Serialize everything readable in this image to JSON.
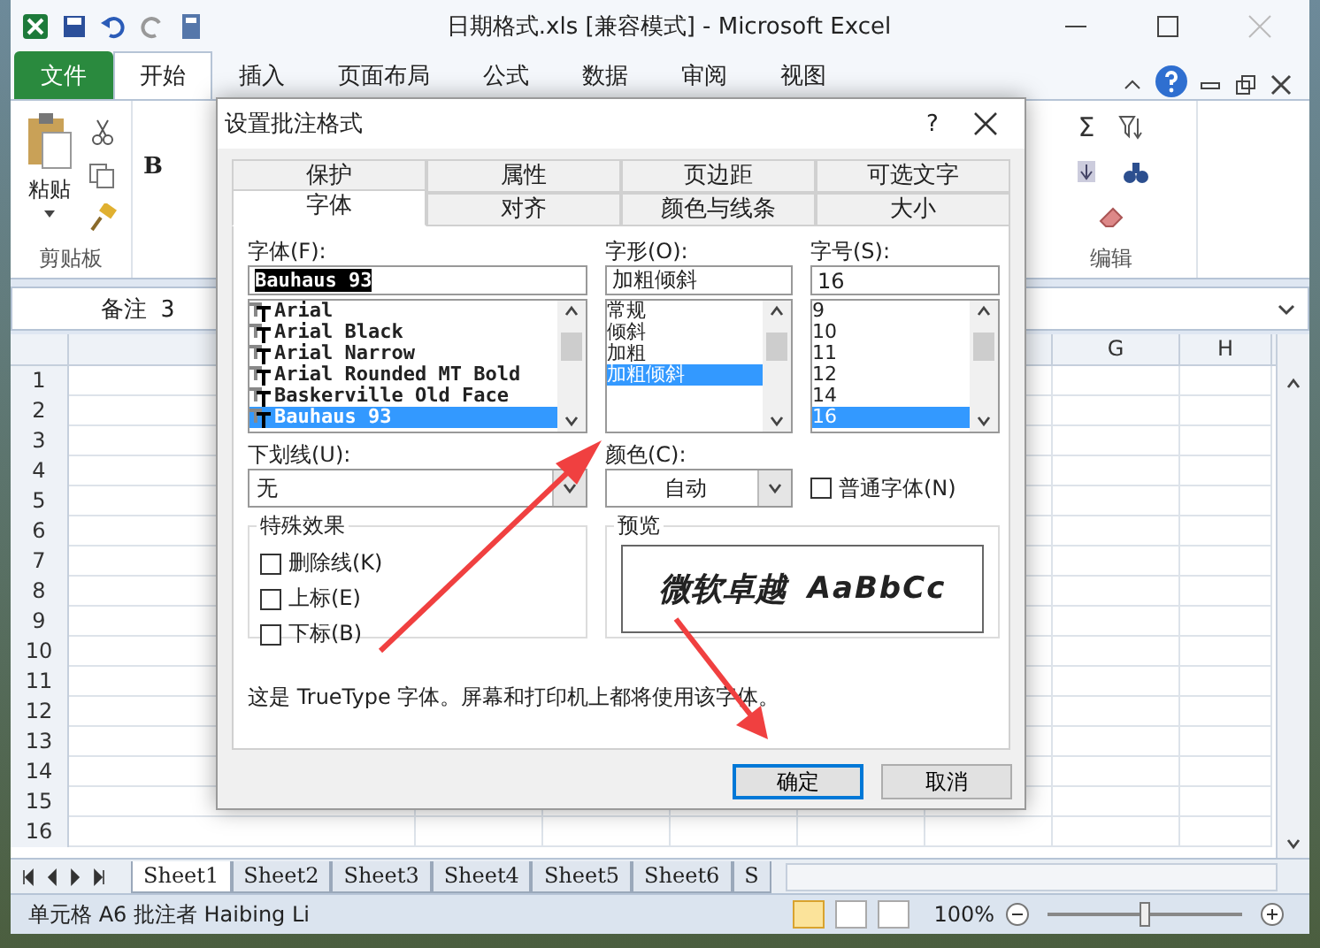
{
  "window": {
    "title": "日期格式.xls  [兼容模式]  -  Microsoft Excel"
  },
  "ribbon_tabs": [
    {
      "label": "文件",
      "kind": "file",
      "selected": false
    },
    {
      "label": "开始",
      "kind": "tab",
      "selected": true
    },
    {
      "label": "插入",
      "kind": "tab",
      "selected": false
    },
    {
      "label": "页面布局",
      "kind": "tab",
      "selected": false
    },
    {
      "label": "公式",
      "kind": "tab",
      "selected": false
    },
    {
      "label": "数据",
      "kind": "tab",
      "selected": false
    },
    {
      "label": "审阅",
      "kind": "tab",
      "selected": false
    },
    {
      "label": "视图",
      "kind": "tab",
      "selected": false
    }
  ],
  "ribbon": {
    "paste": "粘贴",
    "clipboard_group": "剪贴板",
    "bold": "B",
    "sum": "Σ",
    "edit_group": "编辑"
  },
  "name_box": "备注 3",
  "columns": [
    "G",
    "H"
  ],
  "rows": [
    "1",
    "2",
    "3",
    "4",
    "5",
    "6",
    "7",
    "8",
    "9",
    "10",
    "11",
    "12",
    "13",
    "14",
    "15",
    "16"
  ],
  "sheet_tabs": [
    {
      "label": "Sheet1",
      "selected": true
    },
    {
      "label": "Sheet2",
      "selected": false
    },
    {
      "label": "Sheet3",
      "selected": false
    },
    {
      "label": "Sheet4",
      "selected": false
    },
    {
      "label": "Sheet5",
      "selected": false
    },
    {
      "label": "Sheet6",
      "selected": false
    },
    {
      "label": "S",
      "selected": false
    }
  ],
  "status_bar": {
    "text": "单元格 A6 批注者 Haibing Li",
    "zoom": "100%",
    "zoom_slider": {
      "level": 0.5
    }
  },
  "dialog": {
    "title": "设置批注格式",
    "help": "?",
    "tabs_back": [
      {
        "label": "保护",
        "selected": false
      },
      {
        "label": "属性",
        "selected": false
      },
      {
        "label": "页边距",
        "selected": false
      },
      {
        "label": "可选文字",
        "selected": false
      }
    ],
    "tabs_front": [
      {
        "label": "字体",
        "selected": true
      },
      {
        "label": "对齐",
        "selected": false
      },
      {
        "label": "颜色与线条",
        "selected": false
      },
      {
        "label": "大小",
        "selected": false
      }
    ],
    "font": {
      "label": "字体(F):",
      "value": "Bauhaus 93",
      "items": [
        {
          "label": "Arial",
          "selected": false
        },
        {
          "label": "Arial Black",
          "selected": false
        },
        {
          "label": "Arial Narrow",
          "selected": false
        },
        {
          "label": "Arial Rounded MT Bold",
          "selected": false
        },
        {
          "label": "Baskerville Old Face",
          "selected": false
        },
        {
          "label": "Bauhaus 93",
          "selected": true
        }
      ]
    },
    "style": {
      "label": "字形(O):",
      "value": "加粗倾斜",
      "items": [
        {
          "label": "常规",
          "selected": false
        },
        {
          "label": "倾斜",
          "selected": false
        },
        {
          "label": "加粗",
          "selected": false
        },
        {
          "label": "加粗倾斜",
          "selected": true
        }
      ]
    },
    "size": {
      "label": "字号(S):",
      "value": "16",
      "items": [
        {
          "label": "9",
          "selected": false
        },
        {
          "label": "10",
          "selected": false
        },
        {
          "label": "11",
          "selected": false
        },
        {
          "label": "12",
          "selected": false
        },
        {
          "label": "14",
          "selected": false
        },
        {
          "label": "16",
          "selected": true
        }
      ]
    },
    "underline": {
      "label": "下划线(U):",
      "value": "无"
    },
    "color": {
      "label": "颜色(C):",
      "value": "自动"
    },
    "normal_font": {
      "label": "普通字体(N)",
      "checked": false
    },
    "effects": {
      "title": "特殊效果",
      "items": [
        {
          "label": "删除线(K)",
          "checked": false
        },
        {
          "label": "上标(E)",
          "checked": false
        },
        {
          "label": "下标(B)",
          "checked": false
        }
      ]
    },
    "preview": {
      "title": "预览",
      "sample_cjk": "微软卓越",
      "sample_latin": "AaBbCc"
    },
    "note": "这是 TrueType 字体。屏幕和打印机上都将使用该字体。",
    "buttons": [
      {
        "label": "确定",
        "kind": "default"
      },
      {
        "label": "取消",
        "kind": "normal"
      }
    ]
  }
}
